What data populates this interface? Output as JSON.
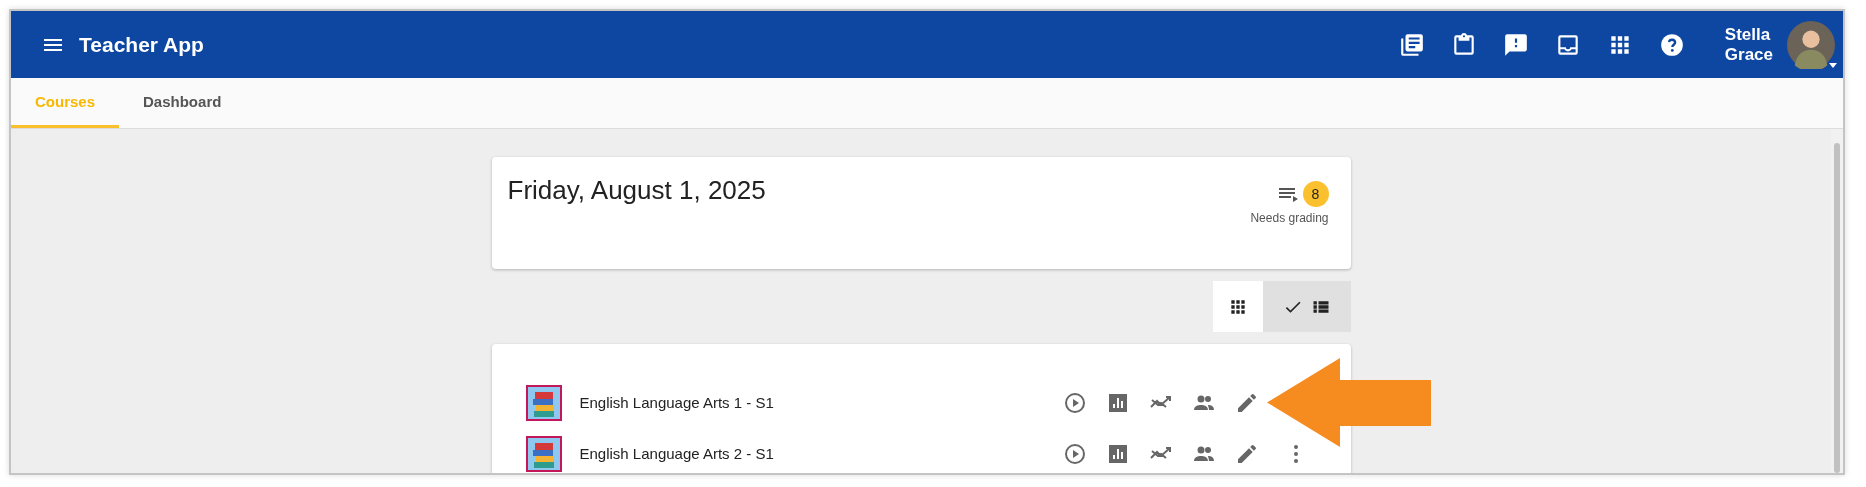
{
  "header": {
    "title": "Teacher App",
    "user_name": "Stella Grace"
  },
  "tabs": [
    {
      "label": "Courses",
      "selected": true
    },
    {
      "label": "Dashboard",
      "selected": false
    }
  ],
  "summary": {
    "date": "Friday, August 1, 2025",
    "grading_count": "8",
    "grading_label": "Needs grading"
  },
  "view_toggle": [
    {
      "kind": "grid",
      "selected": false
    },
    {
      "kind": "list",
      "selected": true
    }
  ],
  "courses": [
    {
      "title": "English Language Arts 1 - S1",
      "arrow_pointer": true
    },
    {
      "title": "English Language Arts 2 - S1",
      "arrow_pointer": false
    }
  ]
}
